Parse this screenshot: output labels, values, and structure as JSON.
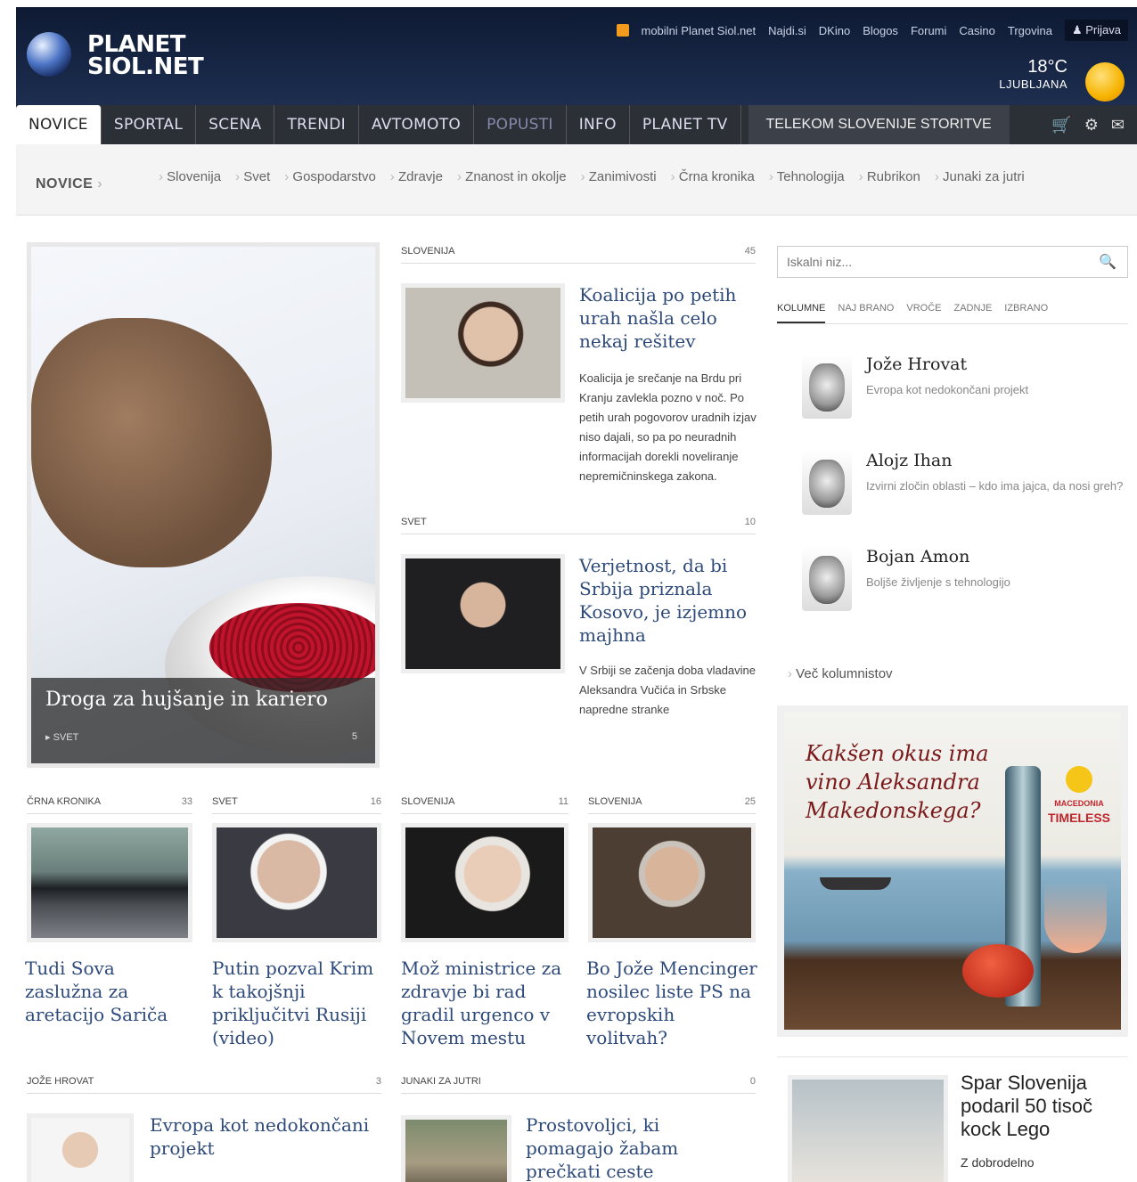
{
  "header": {
    "logo_line1": "PLANET",
    "logo_line2": "SIOL.NET",
    "links": [
      "mobilni Planet Siol.net",
      "Najdi.si",
      "DKino",
      "Blogos",
      "Forumi",
      "Casino",
      "Trgovina"
    ],
    "login": "Prijava",
    "weather": {
      "temp": "18°C",
      "city": "LJUBLJANA"
    }
  },
  "nav": {
    "tabs": [
      "NOVICE",
      "SPORTAL",
      "SCENA",
      "TRENDI",
      "AVTOMOTO",
      "POPUSTI",
      "INFO",
      "PLANET TV"
    ],
    "storitve": "TELEKOM SLOVENIJE STORITVE"
  },
  "subnav": {
    "label": "NOVICE",
    "links": [
      "Slovenija",
      "Svet",
      "Gospodarstvo",
      "Zdravje",
      "Znanost in okolje",
      "Zanimivosti",
      "Črna kronika",
      "Tehnologija",
      "Rubrikon",
      "Junaki za jutri"
    ]
  },
  "hero": {
    "title": "Droga za hujšanje in kariero",
    "category": "SVET",
    "count": "5"
  },
  "articles": [
    {
      "section": "SLOVENIJA",
      "count": "45",
      "title": "Koalicija po petih urah našla celo nekaj rešitev",
      "text": "Koalicija je srečanje na Brdu pri Kranju zavlekla pozno v noč. Po petih urah pogovorov uradnih izjav niso dajali, so pa po neuradnih informacijah dorekli noveliranje nepremičninskega zakona."
    },
    {
      "section": "SVET",
      "count": "10",
      "title": "Verjetnost, da bi Srbija priznala Kosovo, je izjemno majhna",
      "text": "V Srbiji se začenja doba vladavine Aleksandra Vučića in Srbske napredne stranke"
    }
  ],
  "grid": [
    {
      "section": "ČRNA KRONIKA",
      "count": "33",
      "title": "Tudi Sova zaslužna za aretacijo Sariča"
    },
    {
      "section": "SVET",
      "count": "16",
      "title": "Putin pozval Krim k takojšnji priključitvi Rusiji (video)"
    },
    {
      "section": "SLOVENIJA",
      "count": "11",
      "title": "Mož ministrice za zdravje bi rad gradil urgenco v Novem mestu"
    },
    {
      "section": "SLOVENIJA",
      "count": "25",
      "title": "Bo Jože Mencinger nosilec liste PS na evropskih volitvah?"
    }
  ],
  "bottom": [
    {
      "section": "JOŽE HROVAT",
      "count": "3",
      "title": "Evropa kot nedokončani projekt"
    },
    {
      "section": "JUNAKI ZA JUTRI",
      "count": "0",
      "title": "Prostovoljci, ki pomagajo žabam prečkati ceste"
    }
  ],
  "sidebar": {
    "search_placeholder": "Iskalni niz...",
    "tabs": [
      "KOLUMNE",
      "NAJ BRANO",
      "VROČE",
      "ZADNJE",
      "IZBRANO"
    ],
    "columnists": [
      {
        "name": "Jože Hrovat",
        "desc": "Evropa kot nedokončani projekt"
      },
      {
        "name": "Alojz Ihan",
        "desc": "Izvirni zločin oblasti – kdo ima jajca, da nosi greh?"
      },
      {
        "name": "Bojan Amon",
        "desc": "Boljše življenje s tehnologijo"
      }
    ],
    "more": "Več kolumnistov",
    "ad": {
      "text": "Kakšen okus ima vino Aleksandra Makedonskega?",
      "brand_line1": "MACEDONIA",
      "brand_line2": "TIMELESS"
    },
    "promo": {
      "title": "Spar Slovenija podaril 50 tisoč kock Lego",
      "desc": "Z dobrodelno"
    }
  }
}
